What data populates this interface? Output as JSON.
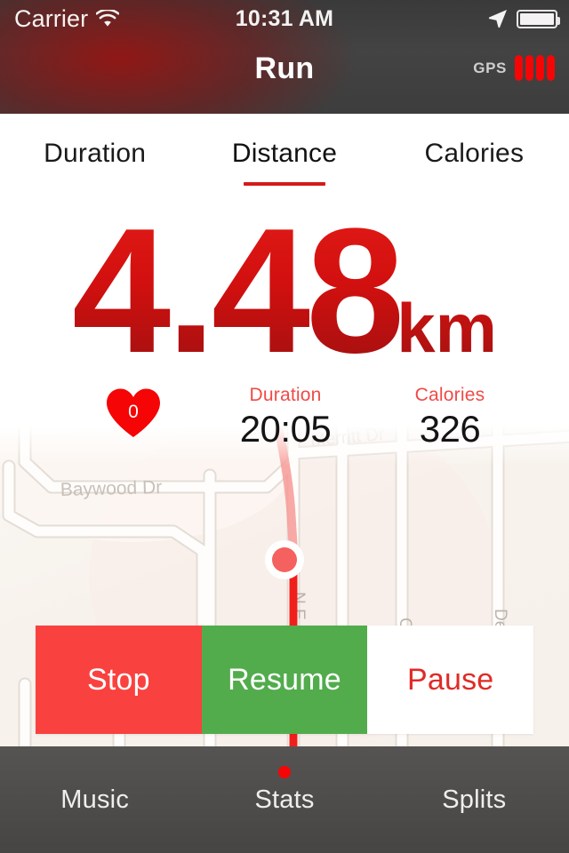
{
  "status_bar": {
    "carrier": "Carrier",
    "wifi_icon": "wifi-icon",
    "time": "10:31 AM",
    "location_icon": "location-arrow-icon",
    "battery_icon": "battery-full-icon"
  },
  "header": {
    "title": "Run",
    "gps_label": "GPS",
    "gps_bars": 4,
    "gps_bar_color": "#f50505"
  },
  "tabs": {
    "items": [
      {
        "label": "Duration",
        "active": false
      },
      {
        "label": "Distance",
        "active": true
      },
      {
        "label": "Calories",
        "active": false
      }
    ],
    "active_index": 1,
    "indicator_color": "#d51a1a"
  },
  "hero": {
    "value": "4.48",
    "unit": "km",
    "color": "#d2100f"
  },
  "stats": {
    "heart_rate": {
      "icon": "heart-icon",
      "value": "0",
      "color": "#f50505"
    },
    "duration": {
      "label": "Duration",
      "value": "20:05"
    },
    "calories": {
      "label": "Calories",
      "value": "326"
    },
    "label_color": "#ef4b47"
  },
  "map": {
    "street_labels": [
      "Baywood Dr",
      "Merritt Dr",
      "N E",
      "C",
      "De"
    ],
    "route_color_active": "#f23a37",
    "route_color_trail": "#f79a96",
    "marker": "current-position-marker",
    "background_color": "#f7f2ec"
  },
  "actions": {
    "buttons": [
      {
        "label": "Stop",
        "background": "#f9423f",
        "text_color": "#ffffff"
      },
      {
        "label": "Resume",
        "background": "#52ac4c",
        "text_color": "#ffffff"
      },
      {
        "label": "Pause",
        "background": "#ffffff",
        "text_color": "#e02b27"
      }
    ]
  },
  "bottom_bar": {
    "items": [
      {
        "label": "Music",
        "active": false
      },
      {
        "label": "Stats",
        "active": true
      },
      {
        "label": "Splits",
        "active": false
      }
    ],
    "active_dot_color": "#f50505"
  }
}
